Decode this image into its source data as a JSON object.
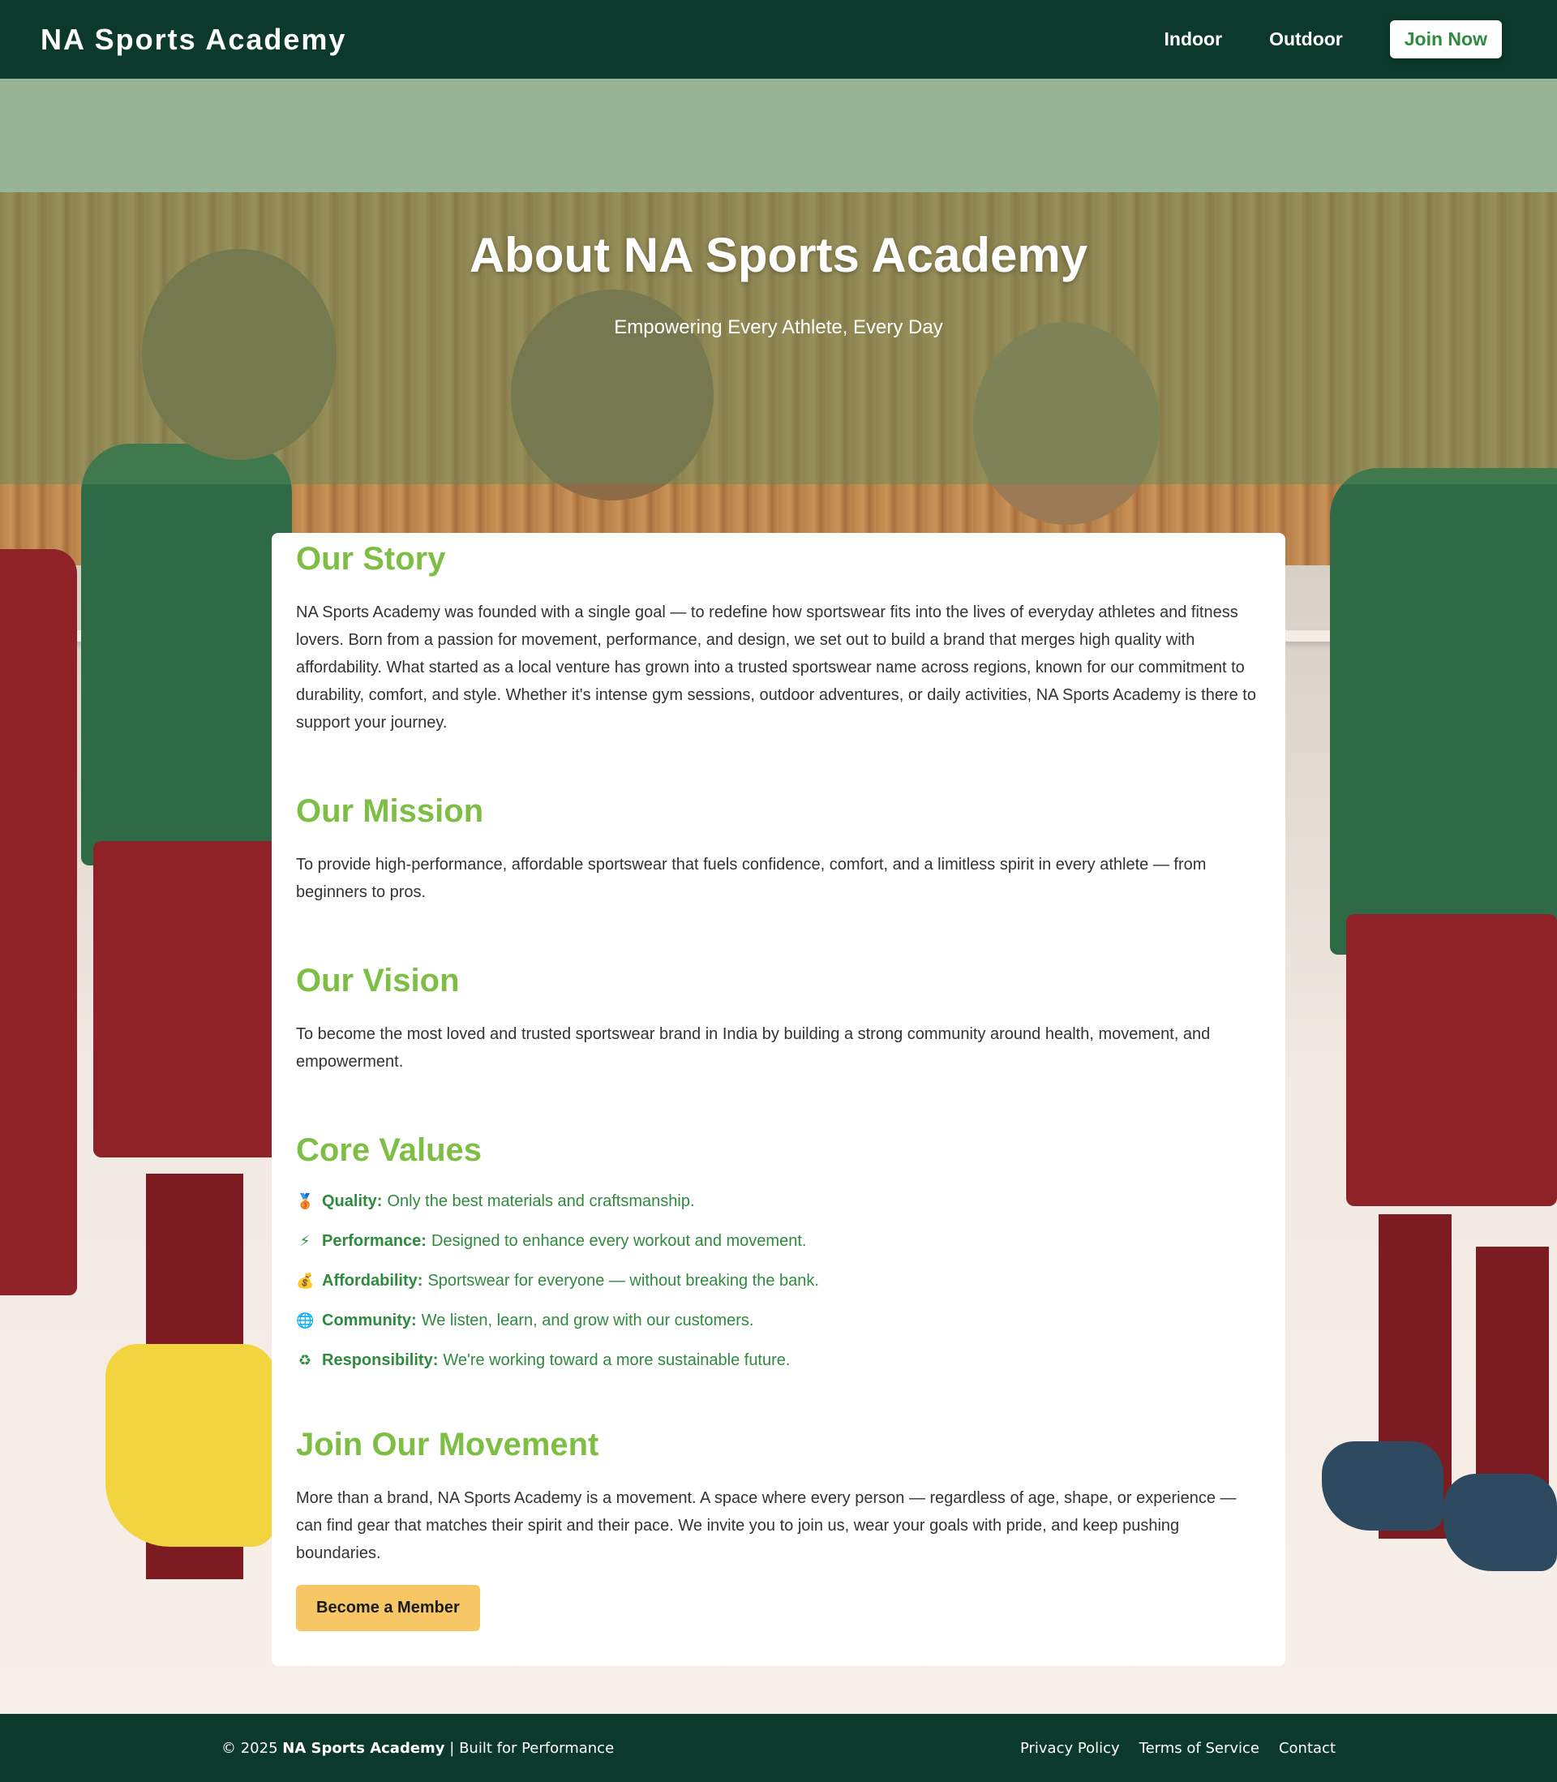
{
  "header": {
    "brand": "NA Sports Academy",
    "nav": [
      "Indoor",
      "Outdoor"
    ],
    "join_label": "Join Now"
  },
  "hero": {
    "title": "About NA Sports Academy",
    "subtitle": "Empowering Every Athlete, Every Day"
  },
  "sections": {
    "story": {
      "title": "Our Story",
      "text": "NA Sports Academy was founded with a single goal — to redefine how sportswear fits into the lives of everyday athletes and fitness lovers. Born from a passion for movement, performance, and design, we set out to build a brand that merges high quality with affordability. What started as a local venture has grown into a trusted sportswear name across regions, known for our commitment to durability, comfort, and style. Whether it's intense gym sessions, outdoor adventures, or daily activities, NA Sports Academy is there to support your journey."
    },
    "mission": {
      "title": "Our Mission",
      "text": "To provide high-performance, affordable sportswear that fuels confidence, comfort, and a limitless spirit in every athlete — from beginners to pros."
    },
    "vision": {
      "title": "Our Vision",
      "text": "To become the most loved and trusted sportswear brand in India by building a strong community around health, movement, and empowerment."
    },
    "values": {
      "title": "Core Values",
      "items": [
        {
          "icon": "🥉",
          "name": "Quality:",
          "text": "Only the best materials and craftsmanship."
        },
        {
          "icon": "⚡",
          "name": "Performance:",
          "text": "Designed to enhance every workout and movement."
        },
        {
          "icon": "💰",
          "name": "Affordability:",
          "text": "Sportswear for everyone — without breaking the bank."
        },
        {
          "icon": "🌐",
          "name": "Community:",
          "text": "We listen, learn, and grow with our customers."
        },
        {
          "icon": "♻",
          "name": "Responsibility:",
          "text": "We're working toward a more sustainable future."
        }
      ]
    },
    "join": {
      "title": "Join Our Movement",
      "text": "More than a brand, NA Sports Academy is a movement. A space where every person — regardless of age, shape, or experience — can find gear that matches their spirit and their pace. We invite you to join us, wear your goals with pride, and keep pushing boundaries.",
      "button": "Become a Member"
    }
  },
  "footer": {
    "copyright_prefix": "© 2025",
    "brand": "NA Sports Academy",
    "suffix": "| Built for Performance",
    "links": [
      "Privacy Policy",
      "Terms of Service",
      "Contact"
    ]
  },
  "colors": {
    "header_bg": "#0b3a2c",
    "heading": "#7ebe45",
    "value_text": "#2e8b3e",
    "member_button": "#f7c765"
  }
}
